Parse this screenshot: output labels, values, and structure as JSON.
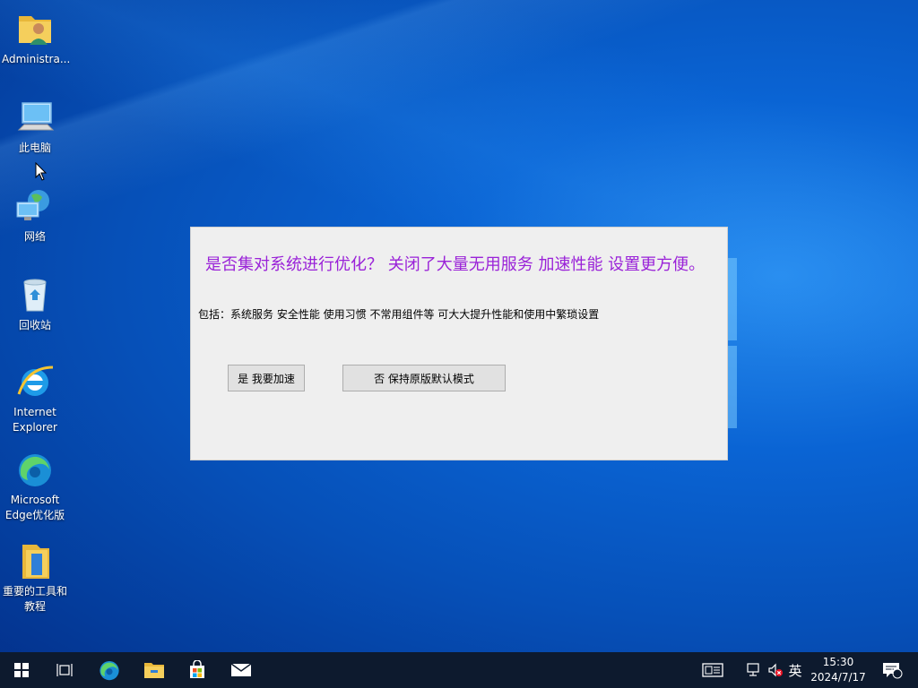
{
  "desktop": {
    "icons": [
      {
        "label": "Administra...",
        "icon": "user-folder-icon"
      },
      {
        "label": "此电脑",
        "icon": "computer-icon"
      },
      {
        "label": "网络",
        "icon": "network-icon"
      },
      {
        "label": "回收站",
        "icon": "recycle-bin-icon"
      },
      {
        "label": "Internet Explorer",
        "icon": "internet-explorer-icon"
      },
      {
        "label": "Microsoft Edge优化版",
        "icon": "edge-icon"
      },
      {
        "label": "重要的工具和教程",
        "icon": "folder-icon"
      }
    ]
  },
  "dialog": {
    "heading": "是否集对系统进行优化？ 关闭了大量无用服务 加速性能 设置更方便。",
    "detail": "包括：系统服务   安全性能  使用习惯  不常用组件等  可大大提升性能和使用中繁琐设置",
    "yes_button": "是 我要加速",
    "no_button": "否    保持原版默认模式",
    "heading_color": "#9a22d8"
  },
  "taskbar": {
    "start": "windows-start-icon",
    "task_view": "task-view-icon",
    "pinned": [
      {
        "name": "Microsoft Edge",
        "icon": "edge-icon"
      },
      {
        "name": "File Explorer",
        "icon": "file-explorer-icon"
      },
      {
        "name": "Microsoft Store",
        "icon": "store-icon"
      },
      {
        "name": "Mail",
        "icon": "mail-icon"
      }
    ],
    "tray": {
      "input_method_label": "英",
      "time": "15:30",
      "date": "2024/7/17",
      "notification_count": "1"
    }
  }
}
